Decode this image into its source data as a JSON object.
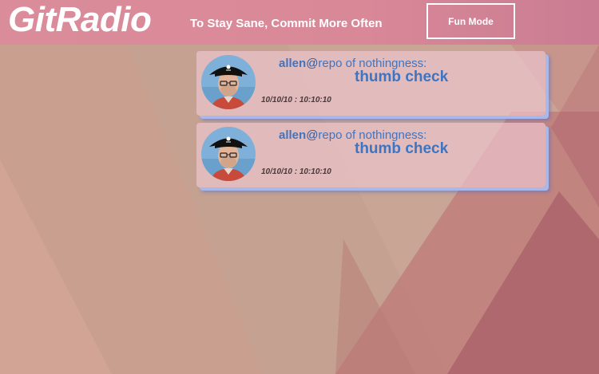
{
  "app": {
    "logo": "GitRadio",
    "tagline": "To Stay Sane, Commit More Often",
    "fun_mode_label": "Fun Mode"
  },
  "feed": [
    {
      "user": "allen",
      "at": "@",
      "repo": "repo of nothingness:",
      "message": "thumb check",
      "timestamp": "10/10/10 : 10:10:10",
      "avatar_icon": "pirate-avatar"
    },
    {
      "user": "allen",
      "at": "@",
      "repo": "repo of nothingness:",
      "message": "thumb check",
      "timestamp": "10/10/10 : 10:10:10",
      "avatar_icon": "pirate-avatar"
    }
  ],
  "colors": {
    "header": "#db8c9a",
    "link_blue": "#3f74c0",
    "card_shadow": "#a9b8ea"
  }
}
